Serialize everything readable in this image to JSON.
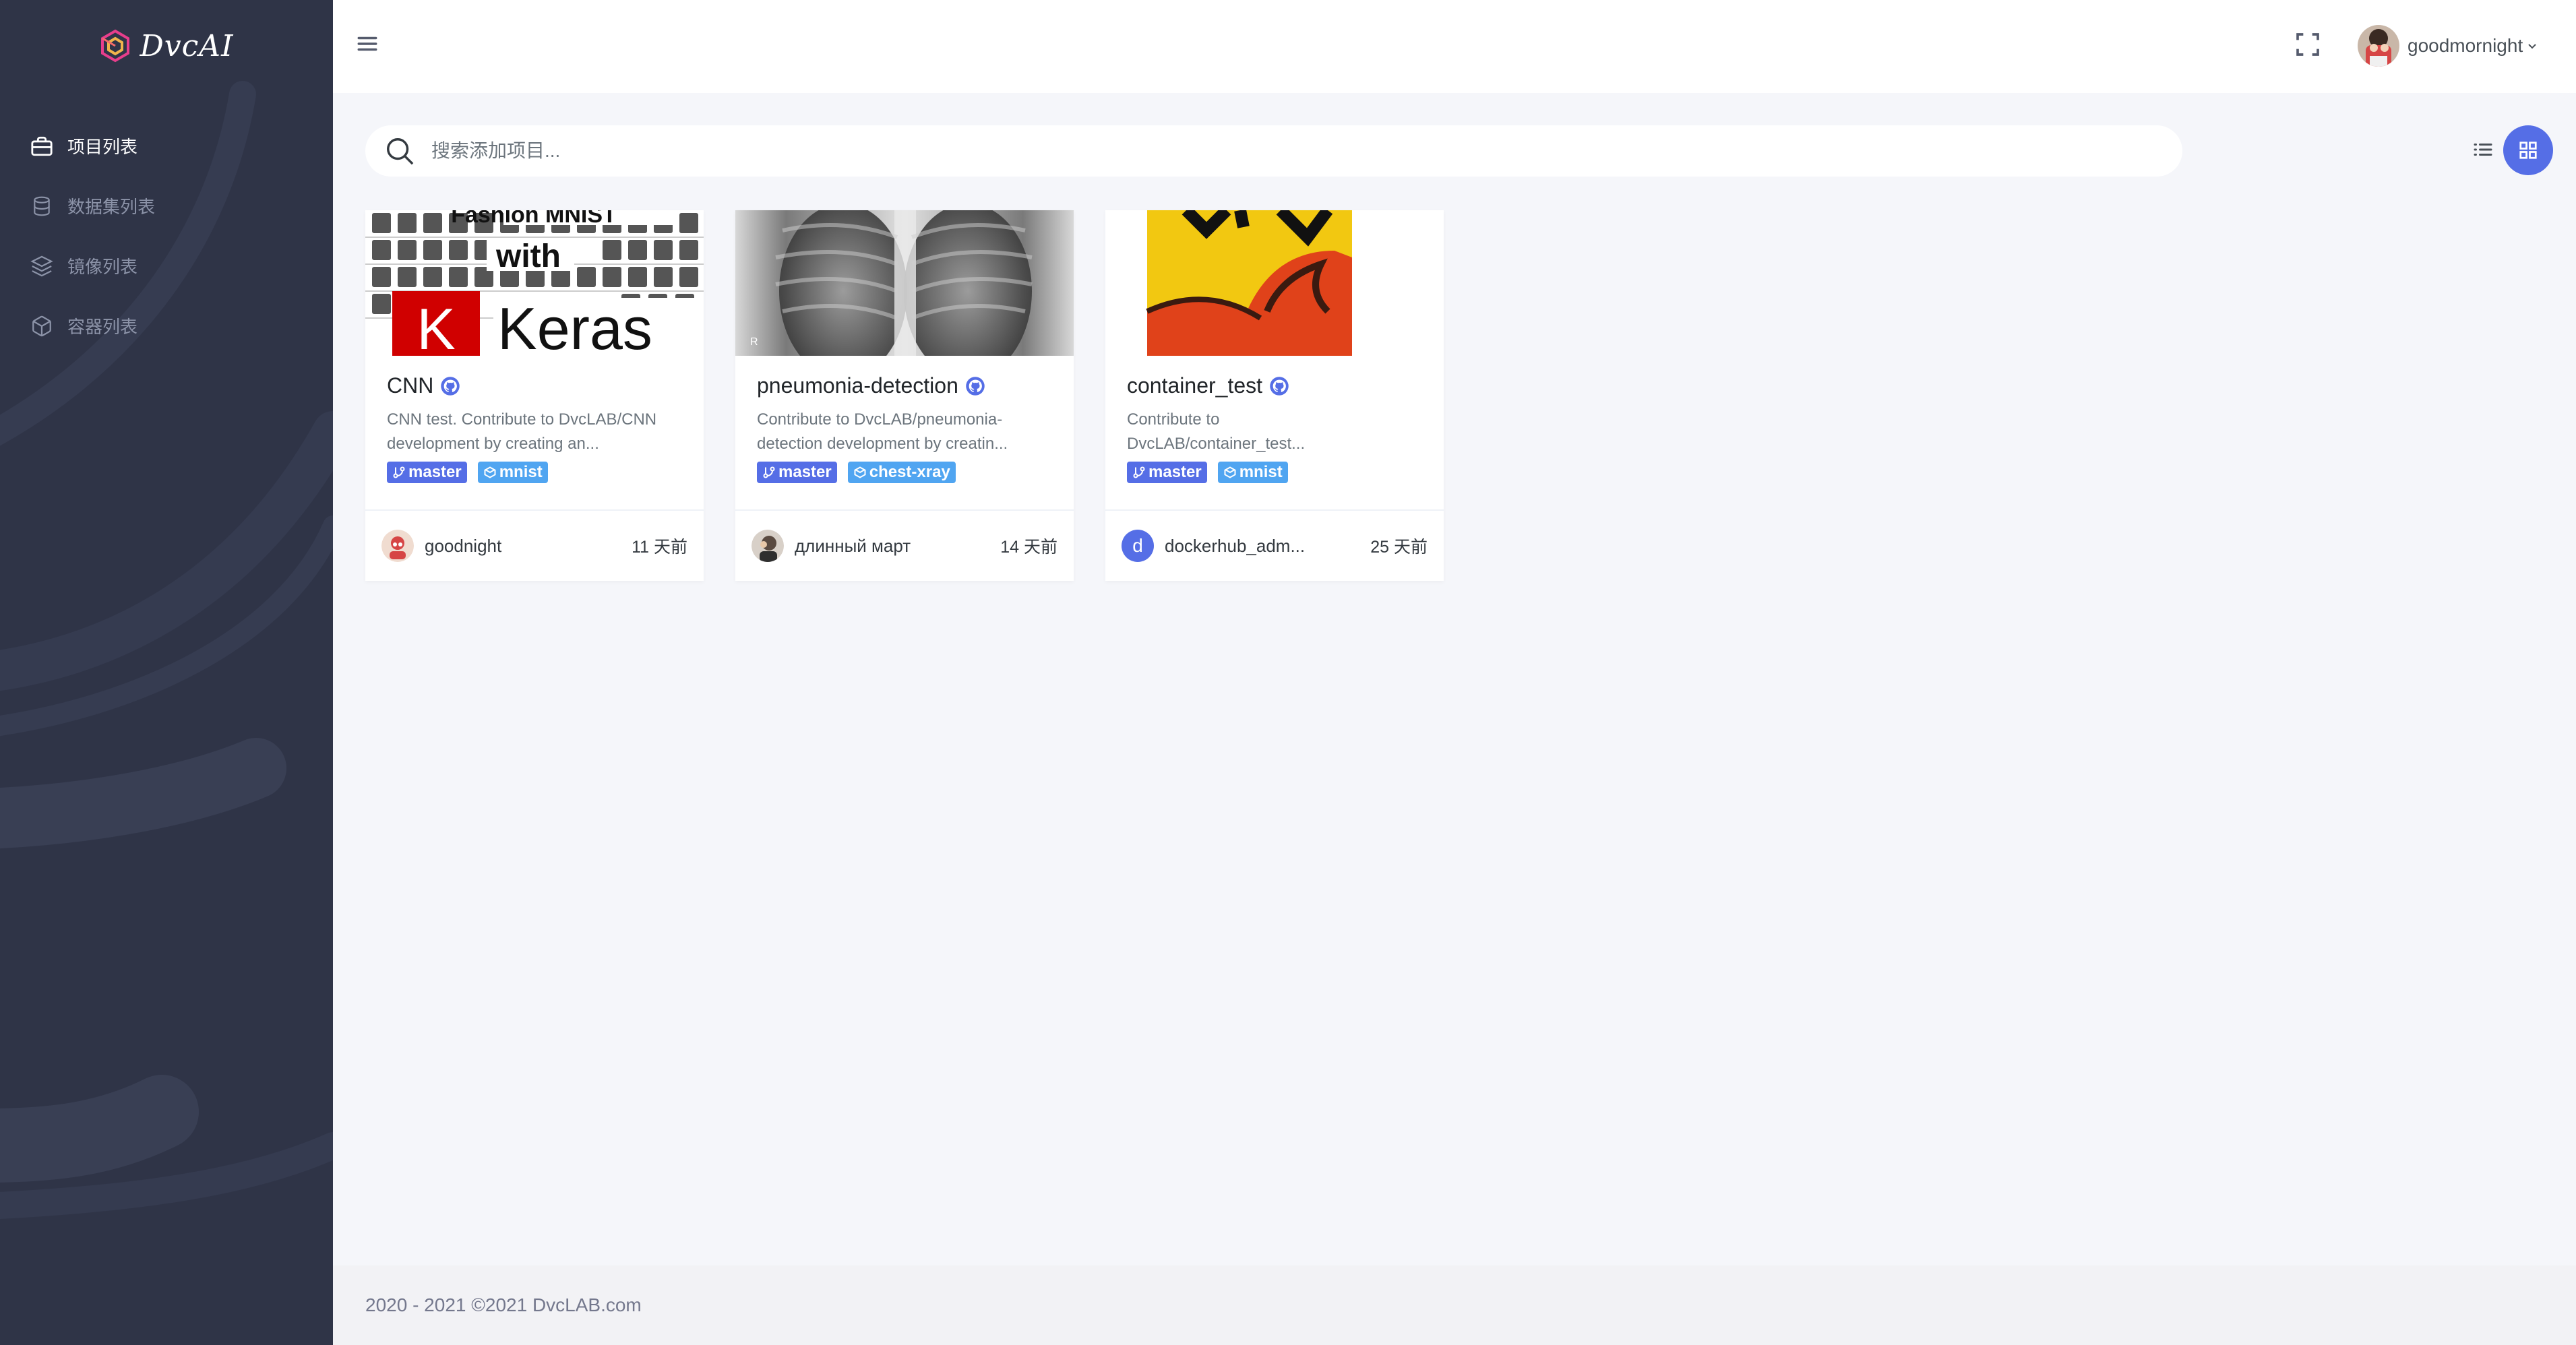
{
  "app": {
    "name": "DvcAI"
  },
  "sidebar": {
    "items": [
      {
        "label": "项目列表",
        "icon": "briefcase-icon",
        "active": true
      },
      {
        "label": "数据集列表",
        "icon": "database-icon",
        "active": false
      },
      {
        "label": "镜像列表",
        "icon": "layers-icon",
        "active": false
      },
      {
        "label": "容器列表",
        "icon": "box-icon",
        "active": false
      }
    ]
  },
  "header": {
    "username": "goodmornight",
    "menu_icon": "hamburger-icon",
    "fullscreen_icon": "fullscreen-icon"
  },
  "search": {
    "placeholder": "搜索添加项目..."
  },
  "view": {
    "active": "grid"
  },
  "colors": {
    "primary": "#556ee6",
    "info": "#50a5f1",
    "sidebar": "#2f3447"
  },
  "projects": [
    {
      "title": "CNN",
      "description": "CNN test. Contribute to DvcLAB/CNN development by creating an...",
      "branch": "master",
      "dataset": "mnist",
      "owner": "goodnight",
      "time": "11 天前",
      "image_text": [
        "Fashion MNIST",
        "with",
        "K",
        "Keras"
      ]
    },
    {
      "title": "pneumonia-detection",
      "description": "Contribute to DvcLAB/pneumonia-detection development by creatin...",
      "branch": "master",
      "dataset": "chest-xray",
      "owner": "длинный март",
      "time": "14 天前",
      "image_text": [
        "R"
      ]
    },
    {
      "title": "container_test",
      "description": "Contribute to DvcLAB/container_test...",
      "branch": "master",
      "dataset": "mnist",
      "owner": "dockerhub_adm...",
      "owner_initial": "d",
      "time": "25 天前",
      "image_text": []
    }
  ],
  "footer": {
    "text": "2020 - 2021 ©2021 DvcLAB.com"
  }
}
